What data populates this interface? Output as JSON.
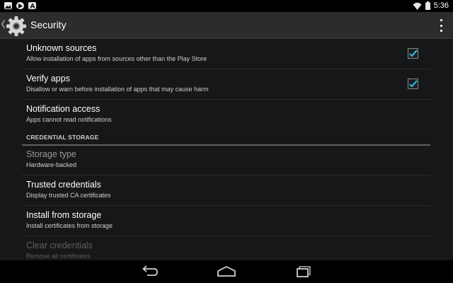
{
  "status_bar": {
    "left_icons": [
      "image-icon",
      "play-store-icon",
      "text-icon"
    ],
    "right_icons": [
      "wifi-icon",
      "battery-icon"
    ],
    "time": "5:36"
  },
  "action_bar": {
    "title": "Security",
    "app_icon": "gear-icon",
    "overflow_icon": "overflow-menu-icon"
  },
  "settings": [
    {
      "title": "Unknown sources",
      "summary": "Allow installation of apps from sources other than the Play Store",
      "checked": true
    },
    {
      "title": "Verify apps",
      "summary": "Disallow or warn before installation of apps that may cause harm",
      "checked": true
    },
    {
      "title": "Notification access",
      "summary": "Apps cannot read notifications"
    }
  ],
  "section": {
    "header": "CREDENTIAL STORAGE"
  },
  "credential_items": [
    {
      "title": "Storage type",
      "summary": "Hardware-backed",
      "state": "dim"
    },
    {
      "title": "Trusted credentials",
      "summary": "Display trusted CA certificates"
    },
    {
      "title": "Install from storage",
      "summary": "Install certificates from storage"
    },
    {
      "title": "Clear credentials",
      "summary": "Remove all certificates",
      "state": "disabled"
    }
  ],
  "nav_bar": {
    "buttons": [
      "back-icon",
      "home-icon",
      "recent-apps-icon"
    ]
  },
  "colors": {
    "accent": "#33b5e5",
    "background": "#161718",
    "action_bar": "#2a2c2e"
  }
}
